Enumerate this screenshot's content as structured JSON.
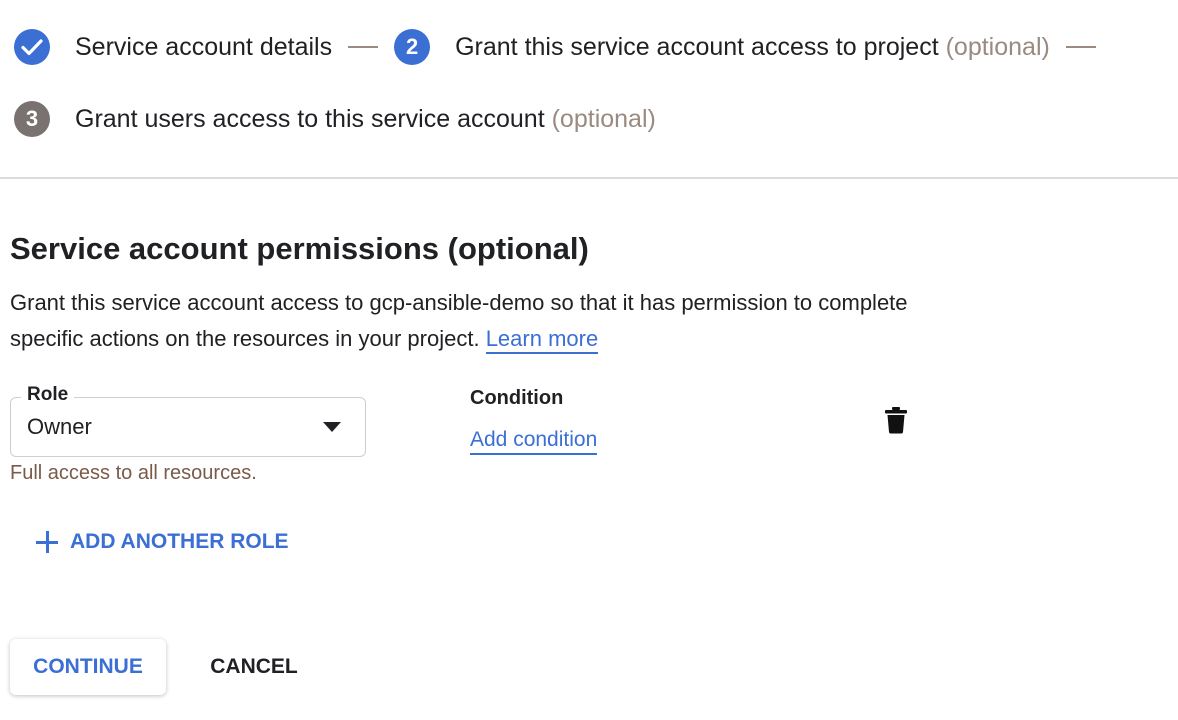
{
  "stepper": {
    "steps": [
      {
        "number": "",
        "label": "Service account details",
        "optional": "",
        "state": "done"
      },
      {
        "number": "2",
        "label": "Grant this service account access to project",
        "optional": "(optional)",
        "state": "active"
      },
      {
        "number": "3",
        "label": "Grant users access to this service account",
        "optional": "(optional)",
        "state": "pending"
      }
    ]
  },
  "section": {
    "title": "Service account permissions (optional)",
    "description": "Grant this service account access to gcp-ansible-demo so that it has permission to complete specific actions on the resources in your project.",
    "learn_more": "Learn more"
  },
  "role": {
    "label": "Role",
    "value": "Owner",
    "hint": "Full access to all resources."
  },
  "condition": {
    "label": "Condition",
    "add_link": "Add condition"
  },
  "actions": {
    "add_role": "ADD ANOTHER ROLE",
    "continue": "CONTINUE",
    "cancel": "CANCEL"
  },
  "icons": {
    "check": "check-icon",
    "dropdown": "dropdown-arrow-icon",
    "delete": "trash-icon",
    "add": "plus-icon"
  },
  "colors": {
    "accent": "#3b6fd4",
    "pending_step": "#7a7270",
    "muted_text": "#9a8a80",
    "hint_text": "#7a5a48"
  }
}
